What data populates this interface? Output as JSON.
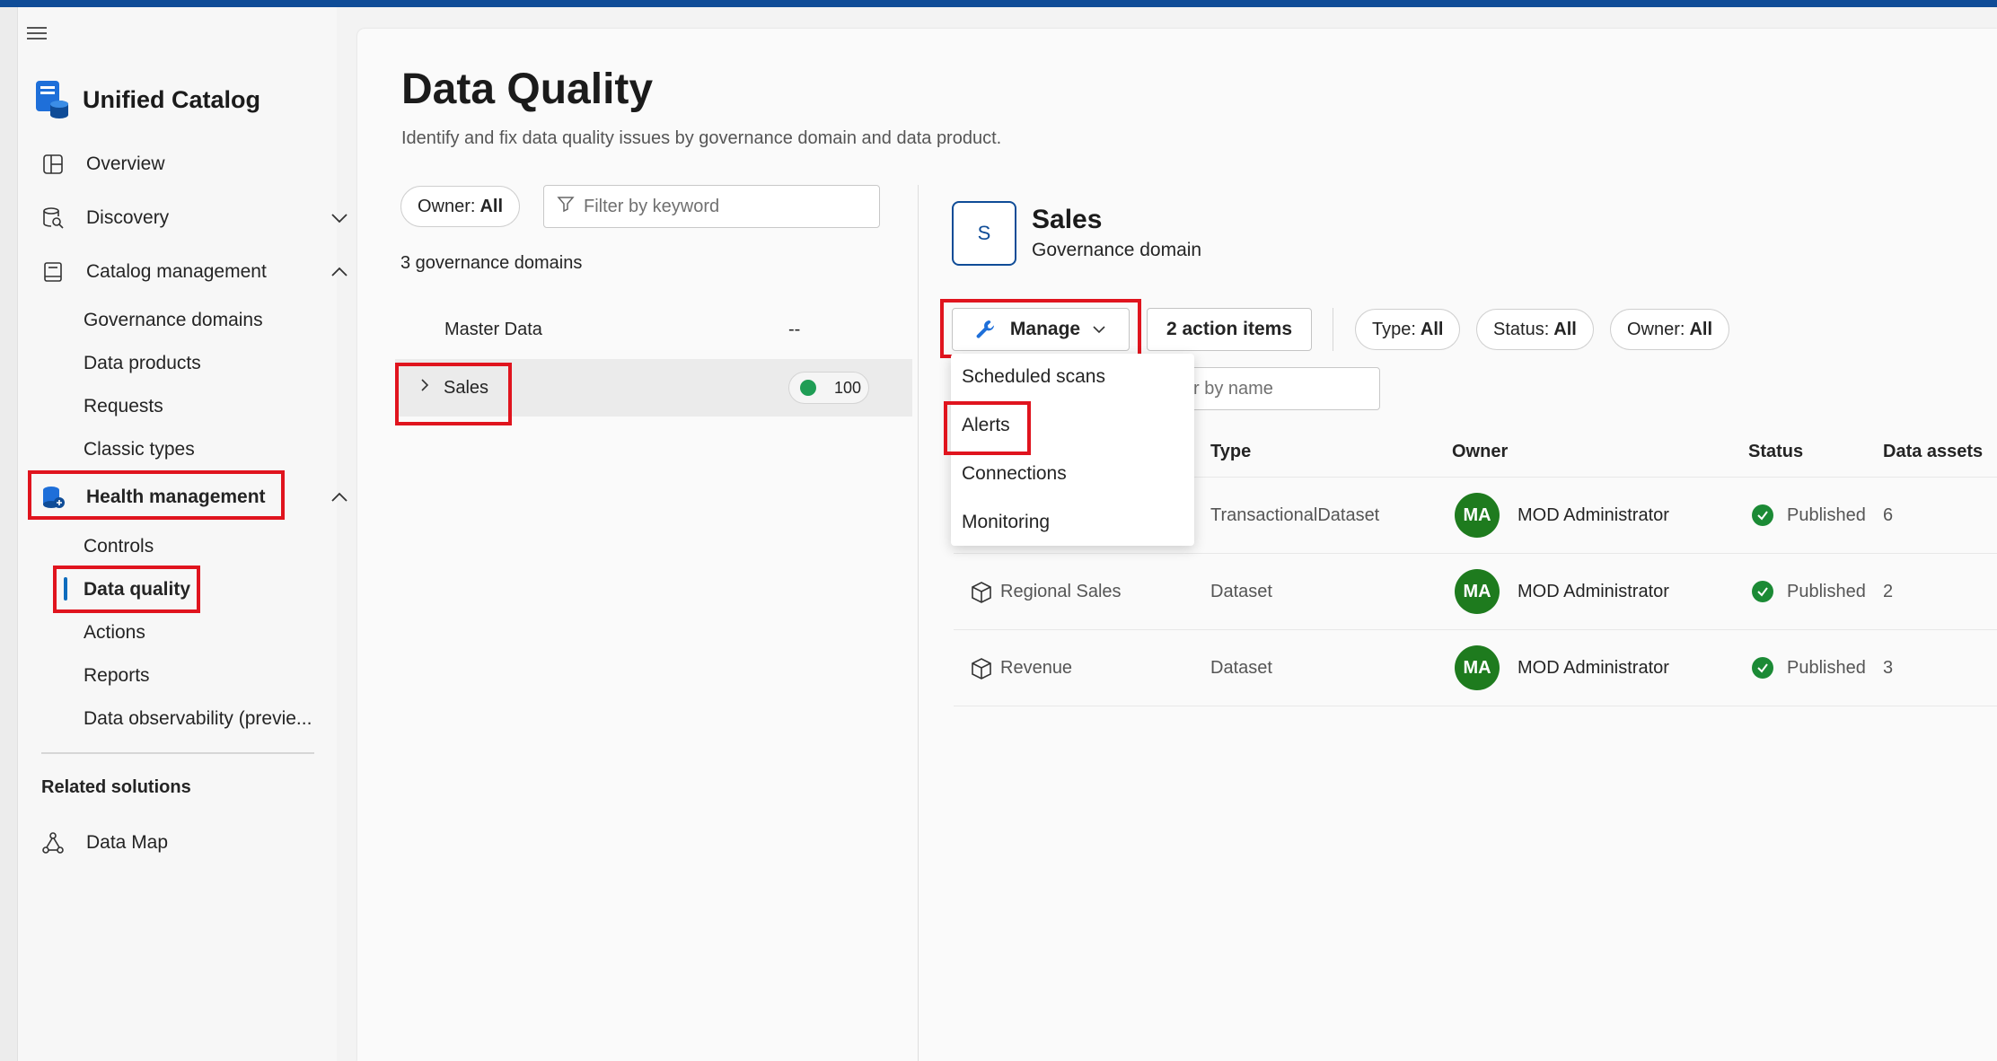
{
  "sidebar": {
    "brand_title": "Unified Catalog",
    "items": {
      "overview": "Overview",
      "discovery": "Discovery",
      "catalog_management": "Catalog management",
      "health_management": "Health management"
    },
    "catalog_sub": [
      "Governance domains",
      "Data products",
      "Requests",
      "Classic types"
    ],
    "health_sub": [
      "Controls",
      "Data quality",
      "Actions",
      "Reports",
      "Data observability (previe..."
    ],
    "related_title": "Related solutions",
    "data_map": "Data Map"
  },
  "main": {
    "title": "Data Quality",
    "subtitle": "Identify and fix data quality issues by governance domain and data product."
  },
  "left_panel": {
    "owner_filter": {
      "label": "Owner:",
      "value": "All"
    },
    "filter_placeholder": "Filter by keyword",
    "count_text": "3 governance domains",
    "domains": [
      {
        "name": "Master Data",
        "score": "--"
      },
      {
        "name": "Sales",
        "score": "100"
      }
    ]
  },
  "detail": {
    "avatar_letter": "S",
    "name": "Sales",
    "type": "Governance domain",
    "manage_label": "Manage",
    "action_items_label": "2 action items",
    "filters": [
      {
        "label": "Type:",
        "value": "All"
      },
      {
        "label": "Status:",
        "value": "All"
      },
      {
        "label": "Owner:",
        "value": "All"
      }
    ],
    "name_filter_partial": "r by name",
    "manage_menu": [
      "Scheduled scans",
      "Alerts",
      "Connections",
      "Monitoring"
    ],
    "columns": {
      "type": "Type",
      "owner": "Owner",
      "status": "Status",
      "assets": "Data assets"
    },
    "rows": [
      {
        "name": "",
        "type": "TransactionalDataset",
        "owner_initials": "MA",
        "owner": "MOD Administrator",
        "status": "Published",
        "assets": "6"
      },
      {
        "name": "Regional Sales",
        "type": "Dataset",
        "owner_initials": "MA",
        "owner": "MOD Administrator",
        "status": "Published",
        "assets": "2"
      },
      {
        "name": "Revenue",
        "type": "Dataset",
        "owner_initials": "MA",
        "owner": "MOD Administrator",
        "status": "Published",
        "assets": "3"
      }
    ]
  }
}
